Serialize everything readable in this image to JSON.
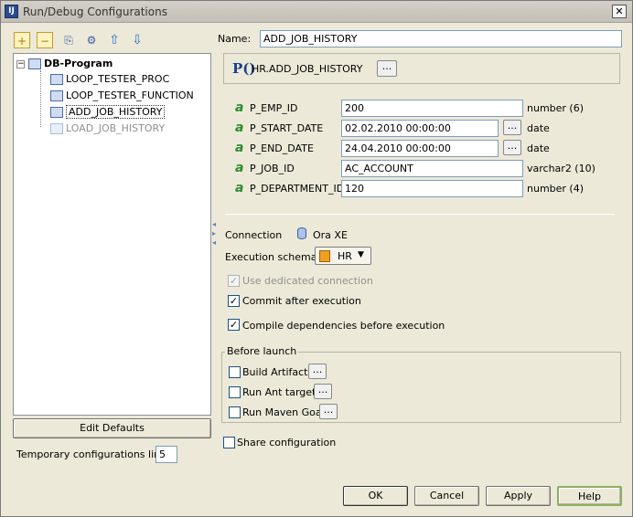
{
  "window": {
    "title": "Run/Debug Configurations",
    "app_icon": "IJ"
  },
  "toolbar": {
    "add": "+",
    "remove": "−",
    "copy": "⎘",
    "edit": "⚙",
    "up": "⇧",
    "down": "⇩"
  },
  "tree": {
    "root": "DB-Program",
    "items": [
      "LOOP_TESTER_PROC",
      "LOOP_TESTER_FUNCTION",
      "ADD_JOB_HISTORY",
      "LOAD_JOB_HISTORY"
    ]
  },
  "left": {
    "edit_defaults": "Edit Defaults",
    "temp_limit_label": "Temporary configurations limit:",
    "temp_limit_value": "5"
  },
  "config": {
    "name_label": "Name:",
    "name_value": "ADD_JOB_HISTORY",
    "proc_icon_text": "P()",
    "procedure": "HR.ADD_JOB_HISTORY",
    "browse": "...",
    "params": [
      {
        "name": "P_EMP_ID",
        "value": "200",
        "type": "number (6)",
        "browse": ""
      },
      {
        "name": "P_START_DATE",
        "value": "02.02.2010 00:00:00",
        "type": "date",
        "browse": "..."
      },
      {
        "name": "P_END_DATE",
        "value": "24.04.2010 00:00:00",
        "type": "date",
        "browse": "..."
      },
      {
        "name": "P_JOB_ID",
        "value": "AC_ACCOUNT",
        "type": "varchar2 (10)",
        "browse": ""
      },
      {
        "name": "P_DEPARTMENT_ID",
        "value": "120",
        "type": "number (4)",
        "browse": ""
      }
    ],
    "param_icon": "a",
    "connection_label": "Connection",
    "connection_value": "Ora XE",
    "schema_label": "Execution schema",
    "schema_value": "HR",
    "dedicated_label": "Use dedicated connection",
    "commit_label": "Commit after execution",
    "compile_label": "Compile dependencies before execution",
    "before_launch_label": "Before launch",
    "build_artifacts": "Build Artifacts",
    "run_ant": "Run Ant target",
    "run_maven": "Run Maven Goal",
    "share_label": "Share configuration",
    "check_mark": "✓"
  },
  "buttons": {
    "ok": "OK",
    "cancel": "Cancel",
    "apply": "Apply",
    "help": "Help"
  }
}
